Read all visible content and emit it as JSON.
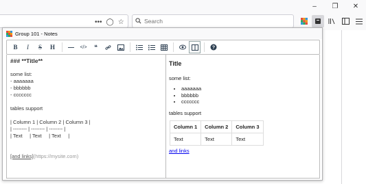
{
  "window": {
    "controls": [
      "minimize-icon",
      "restore-icon",
      "close-icon"
    ]
  },
  "browser_toolbar": {
    "url_icons": [
      "more-actions-icon",
      "pocket-icon",
      "bookmark-star-icon"
    ],
    "search": {
      "placeholder": "Search"
    },
    "right_icons": [
      "extension-icon",
      "notes-extension-icon",
      "library-icon",
      "sidebar-icon",
      "menu-icon"
    ]
  },
  "panel": {
    "title": "Group 101 - Notes",
    "logo_colors": [
      "#e74c3c",
      "#f39c12",
      "#3498db",
      "#27ae60",
      "#e74c3c",
      "#f39c12",
      "#3498db",
      "#27ae60",
      "#e74c3c"
    ]
  },
  "editor_toolbar": {
    "bold": "B",
    "italic": "I",
    "strike": "S",
    "heading": "H",
    "hr": "—",
    "code": "</>",
    "quote": "❝",
    "link": "🔗",
    "image": "🖼",
    "ul": "☰",
    "ol": "☷",
    "table": "▦",
    "preview": "👁",
    "side_by_side": "◫",
    "help": "?"
  },
  "source": {
    "heading": "### **Title**",
    "l1": "some list:",
    "l2": "- aaaaaaa",
    "l3": "- bbbbbb",
    "l4": "- ccccccc",
    "l5": "tables support",
    "t1": "| Column 1 | Column 2 | Column 3 |",
    "t2": "| -------- | -------- | -------- |",
    "t3": "| Text     | Text     | Text     |",
    "link_text": "[and links]",
    "link_url": "(https://mysite.com)"
  },
  "preview": {
    "title": "Title",
    "list_label": "some list:",
    "items": [
      "aaaaaaa",
      "bbbbbb",
      "ccccccc"
    ],
    "tables_label": "tables support",
    "table_headers": [
      "Column 1",
      "Column 2",
      "Column 3"
    ],
    "table_row": [
      "Text",
      "Text",
      "Text"
    ],
    "link": "and links"
  }
}
